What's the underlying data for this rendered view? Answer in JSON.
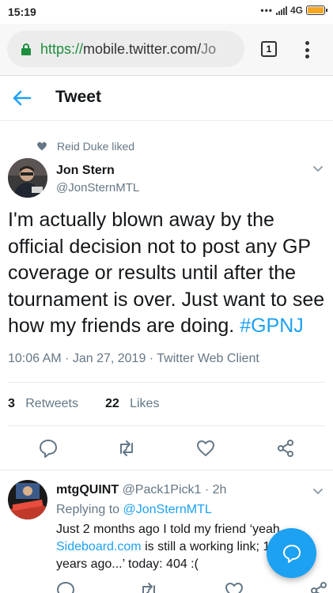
{
  "status_bar": {
    "time": "15:19",
    "network": "4G"
  },
  "browser": {
    "url_scheme": "https://",
    "url_host": "mobile.twitter.com/",
    "url_path": "Jo",
    "tab_count": "1"
  },
  "header": {
    "title": "Tweet"
  },
  "tweet": {
    "social_context": "Reid Duke liked",
    "author_name": "Jon Stern",
    "author_handle": "@JonSternMTL",
    "text": "I'm actually blown away by the official decision not to post any GP coverage or results until after the tournament is over. Just want to see how my friends are doing. ",
    "hashtag": "#GPNJ",
    "meta": "10:06 AM · Jan 27, 2019 · Twitter Web Client",
    "retweets_count": "3",
    "retweets_label": "Retweets",
    "likes_count": "22",
    "likes_label": "Likes"
  },
  "reply": {
    "author_name": "mtgQUINT",
    "author_handle": "@Pack1Pick1 · 2h",
    "replying_prefix": "Replying to ",
    "replying_to": "@JonSternMTL",
    "text_part1": "Just 2 months ago I told my friend ‘yeah ",
    "link": "Sideboard.com",
    "text_part2": " is still a working link; 15 years ago...’ today: 404 :("
  },
  "colors": {
    "accent": "#1da1f2",
    "secure": "#1e8e3e",
    "muted": "#657786"
  },
  "icons": [
    "back-arrow-icon",
    "heart-icon",
    "chevron-down-icon",
    "reply-icon",
    "retweet-icon",
    "like-icon",
    "share-icon",
    "compose-icon",
    "lock-icon"
  ]
}
